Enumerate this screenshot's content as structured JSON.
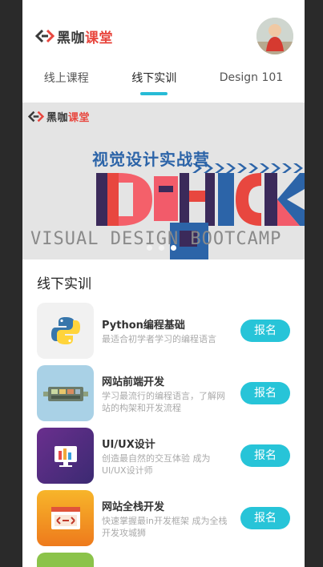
{
  "brand": {
    "part1": "黑咖",
    "part2": "课堂"
  },
  "tabs": [
    {
      "label": "线上课程",
      "active": false
    },
    {
      "label": "线下实训",
      "active": true
    },
    {
      "label": "Design 101",
      "active": false
    }
  ],
  "banner": {
    "cn_title": "视觉设计实战营",
    "en_title": "VISUAL DESIGN BOOTCAMP",
    "dots_active_index": 2
  },
  "section": {
    "title": "线下实训"
  },
  "courses": [
    {
      "title": "Python编程基础",
      "desc": "最适合初学者学习的编程语言",
      "button": "报名",
      "icon": "python-icon",
      "color": "#f1f1f1"
    },
    {
      "title": "网站前端开发",
      "desc": "学习最流行的编程语言，了解网站的构架和开发流程",
      "button": "报名",
      "icon": "frontend-icon",
      "color": "#a9d1e6"
    },
    {
      "title": "UI/UX设计",
      "desc": "创造最自然的交互体验 成为UI/UX设计师",
      "button": "报名",
      "icon": "uiux-icon",
      "color": "#5b2d86"
    },
    {
      "title": "网站全栈开发",
      "desc": "快速掌握最in开发框架 成为全栈开发攻城狮",
      "button": "报名",
      "icon": "fullstack-icon",
      "color": "#f4a41a"
    }
  ],
  "accent": "#27c4d8"
}
